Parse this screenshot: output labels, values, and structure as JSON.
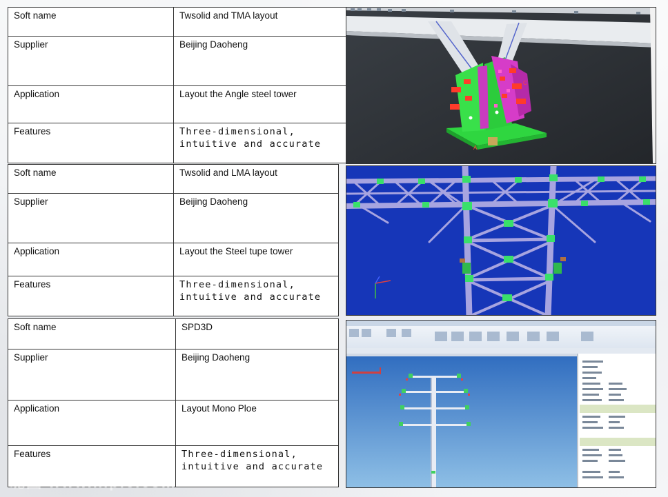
{
  "rows": [
    {
      "soft_label": "Soft name",
      "soft_value": "Twsolid and TMA layout",
      "supplier_label": "Supplier",
      "supplier_value": "Beijing Daoheng",
      "application_label": "Application",
      "application_value": "Layout the Angle steel tower",
      "features_label": "Features",
      "features_value": "Three-dimensional, intuitive and accurate",
      "image": "angle-steel-tower-3d-model"
    },
    {
      "soft_label": "Soft name",
      "soft_value": "Twsolid and LMA layout",
      "supplier_label": "Supplier",
      "supplier_value": "Beijing Daoheng",
      "application_label": "Application",
      "application_value": "Layout the Steel tupe tower",
      "features_label": "Features",
      "features_value": "Three-dimensional, intuitive and accurate",
      "image": "steel-tube-tower-3d-model"
    },
    {
      "soft_label": "Soft name",
      "soft_value": "SPD3D",
      "supplier_label": "Supplier",
      "supplier_value": "Beijing Daoheng",
      "application_label": "Application",
      "application_value": "Layout Mono Ploe",
      "features_label": "Features",
      "features_value": "Three-dimensional, intuitive and accurate",
      "image": "mono-pole-software-screenshot"
    }
  ],
  "colors": {
    "plate_green": "#39e04a",
    "plate_magenta": "#d63cc8",
    "tube_lavender": "#a7a4e0",
    "viewport_blue": "#1636b8"
  }
}
